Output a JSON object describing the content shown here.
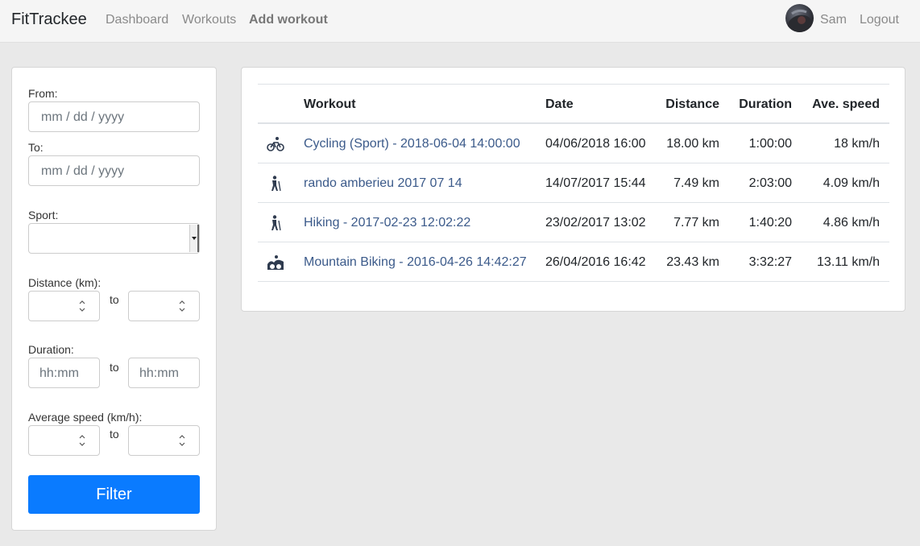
{
  "navbar": {
    "brand": "FitTrackee",
    "links": [
      {
        "label": "Dashboard"
      },
      {
        "label": "Workouts"
      },
      {
        "label": "Add workout"
      }
    ],
    "user": "Sam",
    "logout": "Logout"
  },
  "filters": {
    "from_label": "From:",
    "to_label": "To:",
    "date_placeholder": "mm / dd / yyyy",
    "sport_label": "Sport:",
    "sport_value": "",
    "distance_label": "Distance (km):",
    "duration_label": "Duration:",
    "duration_placeholder": "hh:mm",
    "avg_speed_label": "Average speed (km/h):",
    "range_to": "to",
    "filter_button": "Filter"
  },
  "table": {
    "columns": [
      "Workout",
      "Date",
      "Distance",
      "Duration",
      "Ave. speed"
    ],
    "rows": [
      {
        "icon": "cycling-sport-icon",
        "workout": "Cycling (Sport) - 2018-06-04 14:00:00",
        "date": "04/06/2018 16:00",
        "distance": "18.00 km",
        "duration": "1:00:00",
        "speed": "18 km/h"
      },
      {
        "icon": "hiking-icon",
        "workout": "rando amberieu 2017 07 14",
        "date": "14/07/2017 15:44",
        "distance": "7.49 km",
        "duration": "2:03:00",
        "speed": "4.09 km/h"
      },
      {
        "icon": "hiking-icon",
        "workout": "Hiking - 2017-02-23 12:02:22",
        "date": "23/02/2017 13:02",
        "distance": "7.77 km",
        "duration": "1:40:20",
        "speed": "4.86 km/h"
      },
      {
        "icon": "mountain-biking-icon",
        "workout": "Mountain Biking - 2016-04-26 14:42:27",
        "date": "26/04/2016 16:42",
        "distance": "23.43 km",
        "duration": "3:32:27",
        "speed": "13.11 km/h"
      }
    ]
  },
  "colors": {
    "accent": "#0a7bff",
    "link": "#3b5a8a",
    "background": "#e9e9e9"
  }
}
